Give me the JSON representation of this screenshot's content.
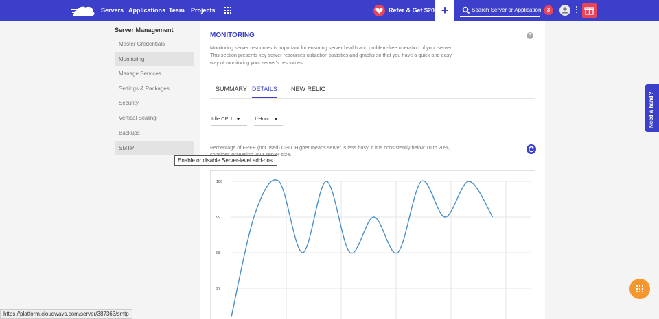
{
  "nav": {
    "links": [
      "Servers",
      "Applications",
      "Team",
      "Projects"
    ],
    "refer_label": "Refer & Get $20",
    "plus_label": "+",
    "search_placeholder": "Search Server or Application",
    "notification_count": "3",
    "accent_color": "#3b3fc9",
    "badge_color": "#e8455a"
  },
  "sidebar": {
    "title": "Server Management",
    "items": [
      {
        "label": "Master Credentials"
      },
      {
        "label": "Monitoring"
      },
      {
        "label": "Manage Services"
      },
      {
        "label": "Settings & Packages"
      },
      {
        "label": "Security"
      },
      {
        "label": "Vertical Scaling"
      },
      {
        "label": "Backups"
      },
      {
        "label": "SMTP"
      }
    ]
  },
  "tooltip": "Enable or disable Server-level add-ons.",
  "main": {
    "title": "MONITORING",
    "help_label": "?",
    "description": "Monitoring server resources is important for ensuring server health and problem-free operation of your server. This section presents key server resources utilization statistics and graphs so that you have a quick and easy way of monitoring your server's resources.",
    "tabs": [
      {
        "label": "SUMMARY",
        "active": false
      },
      {
        "label": "DETAILS",
        "active": true
      },
      {
        "label": "NEW RELIC",
        "active": false
      }
    ],
    "metric_select": "Idle CPU",
    "range_select": "1 Hour",
    "chart_description": "Percentage of FREE (not used) CPU. Higher means server is less busy. If it is consistently below 10 to 20%, consider increasing your server size."
  },
  "chart_data": {
    "type": "line",
    "title": "",
    "xlabel": "",
    "ylabel": "",
    "y_ticks": [
      100,
      99,
      98,
      97
    ],
    "ylim": [
      96.2,
      100.2
    ],
    "series": [
      {
        "values": [
          96.2,
          99.1,
          100.0,
          98.0,
          100.0,
          98.0,
          99.0,
          98.0,
          100.0,
          99.0,
          100.0,
          99.0
        ]
      }
    ],
    "line_color": "#4a90c8",
    "grid": true
  },
  "need_help_label": "Need a hand?",
  "status_url": "https://platform.cloudways.com/server/387363/smtp"
}
